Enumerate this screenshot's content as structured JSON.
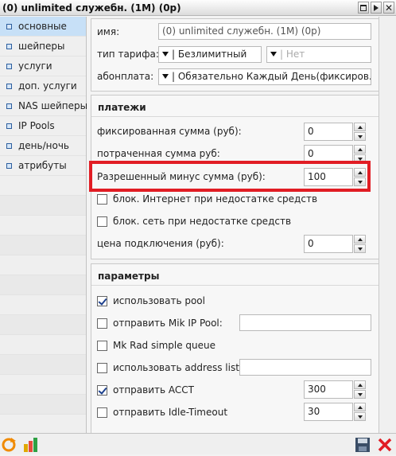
{
  "window": {
    "title": "(0) unlimited служебн. (1M) (0p)"
  },
  "sidebar": {
    "items": [
      {
        "label": "основные",
        "selected": true
      },
      {
        "label": "шейперы"
      },
      {
        "label": "услуги"
      },
      {
        "label": "доп. услуги"
      },
      {
        "label": "NAS шейперы"
      },
      {
        "label": "IP Pools"
      },
      {
        "label": "день/ночь"
      },
      {
        "label": "атрибуты"
      }
    ]
  },
  "general": {
    "name_label": "имя:",
    "name_value": "(0) unlimited служебн. (1M) (0p)",
    "tariff_type_label": "тип тарифа:",
    "tariff_type_value": "| Безлимитный",
    "tariff_type_second": "| Нет",
    "fee_label": "абонплата:",
    "fee_value": "| Обязательно Каждый День(фиксиров..."
  },
  "payments": {
    "title": "платежи",
    "fixed_sum_label": "фиксированная сумма (руб):",
    "fixed_sum_value": "0",
    "spent_sum_label": "потраченная сумма руб:",
    "spent_sum_value": "0",
    "allowed_minus_label": "Разрешенный минус сумма (руб):",
    "allowed_minus_value": "100",
    "block_internet_label": "блок. Интернет при недостатке средств",
    "block_internet_checked": false,
    "block_network_label": "блок. сеть при недостатке средств",
    "block_network_checked": false,
    "connection_price_label": "цена подключения (руб):",
    "connection_price_value": "0"
  },
  "params": {
    "title": "параметры",
    "use_pool_label": "использовать pool",
    "use_pool_checked": true,
    "send_mik_pool_label": "отправить Mik IP Pool:",
    "send_mik_pool_checked": false,
    "send_mik_pool_value": "",
    "mk_rad_label": "Mk Rad simple queue",
    "mk_rad_checked": false,
    "use_address_list_label": "использовать address list:",
    "use_address_list_checked": false,
    "use_address_list_value": "",
    "send_acct_label": "отправить ACCT",
    "send_acct_checked": true,
    "send_acct_value": "300",
    "send_idle_label": "отправить Idle-Timeout",
    "send_idle_checked": false,
    "send_idle_value": "30"
  },
  "colors": {
    "highlight": "#e11d24",
    "selected_bg": "#c7e0f7"
  }
}
